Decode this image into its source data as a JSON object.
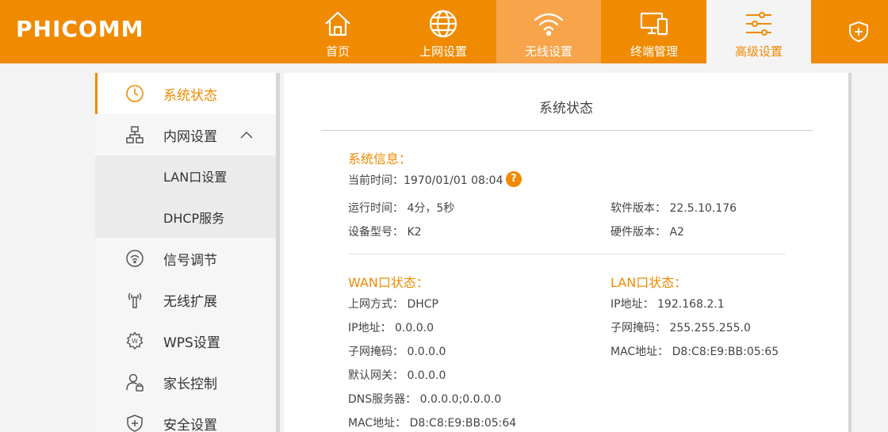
{
  "header": {
    "logo": "PHICOMM",
    "nav": [
      {
        "label": "首页",
        "icon": "home-icon"
      },
      {
        "label": "上网设置",
        "icon": "globe-icon"
      },
      {
        "label": "无线设置",
        "icon": "wifi-icon"
      },
      {
        "label": "终端管理",
        "icon": "devices-icon"
      },
      {
        "label": "高级设置",
        "icon": "sliders-icon"
      }
    ],
    "shield_icon": "shield-plus-icon"
  },
  "sidebar": {
    "items": [
      {
        "label": "系统状态",
        "icon": "clock-icon"
      },
      {
        "label": "内网设置",
        "icon": "network-icon"
      },
      {
        "label": "LAN口设置"
      },
      {
        "label": "DHCP服务"
      },
      {
        "label": "信号调节",
        "icon": "signal-icon"
      },
      {
        "label": "无线扩展",
        "icon": "antenna-icon"
      },
      {
        "label": "WPS设置",
        "icon": "wps-gear-icon"
      },
      {
        "label": "家长控制",
        "icon": "parent-lock-icon"
      },
      {
        "label": "安全设置",
        "icon": "shield-plus-icon"
      }
    ]
  },
  "main": {
    "title": "系统状态",
    "sys": {
      "heading": "系统信息：",
      "current_time": "当前时间：1970/01/01 08:04",
      "help": "?",
      "uptime": "运行时间： 4分，5秒",
      "model": "设备型号： K2",
      "software": "软件版本： 22.5.10.176",
      "hardware": "硬件版本： A2"
    },
    "wan": {
      "heading": "WAN口状态：",
      "mode": "上网方式： DHCP",
      "ip": "IP地址： 0.0.0.0",
      "mask": "子网掩码： 0.0.0.0",
      "gateway": "默认网关： 0.0.0.0",
      "dns": "DNS服务器： 0.0.0.0;0.0.0.0",
      "mac": "MAC地址： D8:C8:E9:BB:05:64"
    },
    "lan": {
      "heading": "LAN口状态：",
      "ip": "IP地址： 192.168.2.1",
      "mask": "子网掩码： 255.255.255.0",
      "mac": "MAC地址： D8:C8:E9:BB:05:65"
    }
  }
}
